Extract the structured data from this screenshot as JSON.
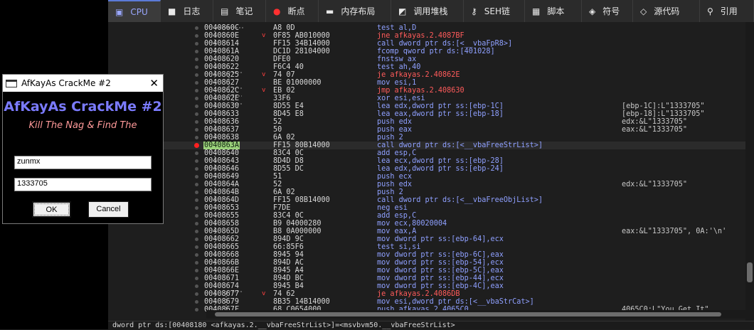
{
  "tabs": [
    {
      "icon": "cpu-icon",
      "glyph": "▣",
      "label": "CPU",
      "active": true
    },
    {
      "icon": "log-icon",
      "glyph": "■",
      "label": "日志"
    },
    {
      "icon": "notes-icon",
      "glyph": "▤",
      "label": "笔记"
    },
    {
      "icon": "breakpoint-icon",
      "glyph": "●",
      "label": "断点"
    },
    {
      "icon": "memory-icon",
      "glyph": "▬",
      "label": "内存布局"
    },
    {
      "icon": "callstack-icon",
      "glyph": "◩",
      "label": "调用堆栈"
    },
    {
      "icon": "seh-icon",
      "glyph": "⚷",
      "label": "SEH链"
    },
    {
      "icon": "script-icon",
      "glyph": "▦",
      "label": "脚本"
    },
    {
      "icon": "symbols-icon",
      "glyph": "◈",
      "label": "符号"
    },
    {
      "icon": "source-icon",
      "glyph": "◇",
      "label": "源代码"
    },
    {
      "icon": "references-icon",
      "glyph": "⚲",
      "label": "引用"
    }
  ],
  "disasm": [
    {
      "addr": "0040860C",
      "bytes": "A8 0D",
      "instr": "test al,D",
      "comment": ""
    },
    {
      "addr": "0040860E",
      "bytes": "0F85 AB010000",
      "instr": "jne afkayas.2.4087BF",
      "comment": "",
      "jump": true,
      "mark": "v"
    },
    {
      "addr": "00408614",
      "bytes": "FF15 34B14000",
      "instr": "call dword ptr ds:[<__vbaFpR8>]",
      "comment": ""
    },
    {
      "addr": "0040861A",
      "bytes": "DC1D 28104000",
      "instr": "fcomp qword ptr ds:[401028]",
      "comment": ""
    },
    {
      "addr": "00408620",
      "bytes": "DFE0",
      "instr": "fnstsw ax",
      "comment": ""
    },
    {
      "addr": "00408622",
      "bytes": "F6C4 40",
      "instr": "test ah,40",
      "comment": ""
    },
    {
      "addr": "00408625",
      "bytes": "74 07",
      "instr": "je afkayas.2.40862E",
      "comment": "",
      "jump": true,
      "mark": "v"
    },
    {
      "addr": "00408627",
      "bytes": "BE 01000000",
      "instr": "mov esi,1",
      "comment": ""
    },
    {
      "addr": "0040862C",
      "bytes": "EB 02",
      "instr": "jmp afkayas.2.408630",
      "comment": "",
      "jump": true,
      "mark": "v"
    },
    {
      "addr": "0040862E",
      "bytes": "33F6",
      "instr": "xor esi,esi",
      "comment": ""
    },
    {
      "addr": "00408630",
      "bytes": "8D55 E4",
      "instr": "lea edx,dword ptr ss:[ebp-1C]",
      "comment": "[ebp-1C]:L\"1333705\""
    },
    {
      "addr": "00408633",
      "bytes": "8D45 E8",
      "instr": "lea eax,dword ptr ss:[ebp-18]",
      "comment": "[ebp-18]:L\"1333705\""
    },
    {
      "addr": "00408636",
      "bytes": "52",
      "instr": "push edx",
      "comment": "edx:&L\"1333705\""
    },
    {
      "addr": "00408637",
      "bytes": "50",
      "instr": "push eax",
      "comment": "eax:&L\"1333705\""
    },
    {
      "addr": "00408638",
      "bytes": "6A 02",
      "instr": "push 2",
      "comment": ""
    },
    {
      "addr": "0040863A",
      "bytes": "FF15 80B14000",
      "instr": "call dword ptr ds:[<__vbaFreeStrList>]",
      "comment": "",
      "selected": true
    },
    {
      "addr": "00408640",
      "bytes": "83C4 0C",
      "instr": "add esp,C",
      "comment": ""
    },
    {
      "addr": "00408643",
      "bytes": "8D4D D8",
      "instr": "lea ecx,dword ptr ss:[ebp-28]",
      "comment": ""
    },
    {
      "addr": "00408646",
      "bytes": "8D55 DC",
      "instr": "lea edx,dword ptr ss:[ebp-24]",
      "comment": ""
    },
    {
      "addr": "00408649",
      "bytes": "51",
      "instr": "push ecx",
      "comment": ""
    },
    {
      "addr": "0040864A",
      "bytes": "52",
      "instr": "push edx",
      "comment": "edx:&L\"1333705\""
    },
    {
      "addr": "0040864B",
      "bytes": "6A 02",
      "instr": "push 2",
      "comment": ""
    },
    {
      "addr": "0040864D",
      "bytes": "FF15 08B14000",
      "instr": "call dword ptr ds:[<__vbaFreeObjList>]",
      "comment": ""
    },
    {
      "addr": "00408653",
      "bytes": "F7DE",
      "instr": "neg esi",
      "comment": ""
    },
    {
      "addr": "00408655",
      "bytes": "83C4 0C",
      "instr": "add esp,C",
      "comment": ""
    },
    {
      "addr": "00408658",
      "bytes": "B9 04000280",
      "instr": "mov ecx,80020004",
      "comment": ""
    },
    {
      "addr": "0040865D",
      "bytes": "B8 0A000000",
      "instr": "mov eax,A",
      "comment": "eax:&L\"1333705\", 0A:'\\n'"
    },
    {
      "addr": "00408662",
      "bytes": "894D 9C",
      "instr": "mov dword ptr ss:[ebp-64],ecx",
      "comment": ""
    },
    {
      "addr": "00408665",
      "bytes": "66:85F6",
      "instr": "test si,si",
      "comment": ""
    },
    {
      "addr": "00408668",
      "bytes": "8945 94",
      "instr": "mov dword ptr ss:[ebp-6C],eax",
      "comment": ""
    },
    {
      "addr": "0040866B",
      "bytes": "894D AC",
      "instr": "mov dword ptr ss:[ebp-54],ecx",
      "comment": ""
    },
    {
      "addr": "0040866E",
      "bytes": "8945 A4",
      "instr": "mov dword ptr ss:[ebp-5C],eax",
      "comment": ""
    },
    {
      "addr": "00408671",
      "bytes": "894D BC",
      "instr": "mov dword ptr ss:[ebp-44],ecx",
      "comment": ""
    },
    {
      "addr": "00408674",
      "bytes": "8945 B4",
      "instr": "mov dword ptr ss:[ebp-4C],eax",
      "comment": ""
    },
    {
      "addr": "00408677",
      "bytes": "74 62",
      "instr": "je afkayas.2.4086DB",
      "comment": "",
      "jump": true,
      "mark": "v"
    },
    {
      "addr": "00408679",
      "bytes": "8B35 14B14000",
      "instr": "mov esi,dword ptr ds:[<__vbaStrCat>]",
      "comment": ""
    },
    {
      "addr": "0040867F",
      "bytes": "68 C0654000",
      "instr": "push afkayas.2.4065C0",
      "comment": "4065C0:L\"You Get It\""
    }
  ],
  "status_text": "dword ptr ds:[00408180 <afkayas.2.__vbaFreeStrList>]=<msvbvm50.__vbaFreeStrList>",
  "dialog": {
    "title": "AfKayAs CrackMe #2",
    "heading": "AfKayAs CrackMe #2",
    "subtitle": "Kill The Nag & Find The",
    "name_value": "zunmx",
    "serial_value": "1333705",
    "ok_label": "OK",
    "cancel_label": "Cancel"
  }
}
